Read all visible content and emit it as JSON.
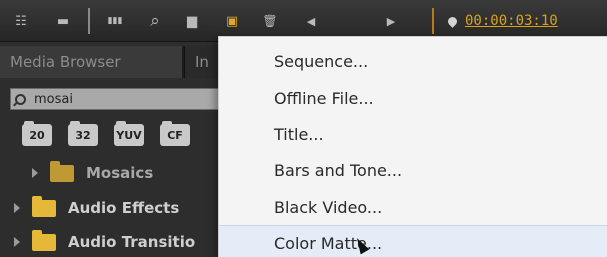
{
  "toolbar": {
    "timecode": "00:00:03:10",
    "buttons": [
      {
        "name": "list-view-icon",
        "glyph": "☷"
      },
      {
        "name": "icon-view-icon",
        "glyph": "▬"
      },
      {
        "name": "automate-icon",
        "glyph": "▮▮▮"
      },
      {
        "name": "find-icon",
        "glyph": "⌕"
      },
      {
        "name": "new-bin-icon",
        "glyph": "▆"
      },
      {
        "name": "new-item-icon",
        "glyph": "▣"
      },
      {
        "name": "clear-icon",
        "glyph": "🗑"
      },
      {
        "name": "step-back-icon",
        "glyph": "◀"
      },
      {
        "name": "step-forward-icon",
        "glyph": "▶"
      }
    ]
  },
  "panel": {
    "tabs": [
      {
        "label": "Media Browser"
      },
      {
        "label": "In"
      }
    ],
    "search_value": "mosai",
    "bin_buttons": [
      "20",
      "32",
      "YUV",
      "CF"
    ],
    "tree": [
      {
        "label": "Mosaics"
      },
      {
        "label": "Audio Effects"
      },
      {
        "label": "Audio Transitio"
      }
    ]
  },
  "menu": {
    "items": [
      {
        "label": "Sequence..."
      },
      {
        "label": "Offline File..."
      },
      {
        "label": "Title..."
      },
      {
        "label": "Bars and Tone..."
      },
      {
        "label": "Black Video..."
      },
      {
        "label": "Color Matte..."
      }
    ]
  },
  "colors": {
    "accent": "#d9a21b",
    "menu_bg": "#f4f4f4",
    "panel_bg": "#2d2d2d",
    "highlight": "#e3ecf7"
  }
}
